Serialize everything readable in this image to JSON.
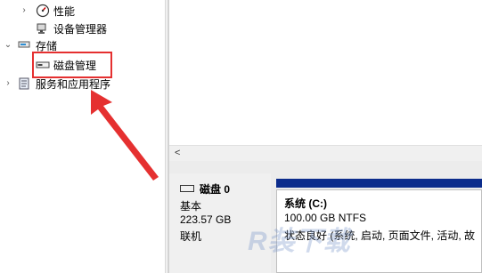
{
  "tree": {
    "items": [
      {
        "label": "性能",
        "icon": "performance-icon"
      },
      {
        "label": "设备管理器",
        "icon": "device-manager-icon"
      },
      {
        "label": "存储",
        "icon": "storage-icon"
      },
      {
        "label": "磁盘管理",
        "icon": "disk-management-icon"
      },
      {
        "label": "服务和应用程序",
        "icon": "services-apps-icon"
      }
    ]
  },
  "disk": {
    "name": "磁盘 0",
    "type": "基本",
    "size": "223.57 GB",
    "status": "联机"
  },
  "volume": {
    "title": "系统 (C:)",
    "size_fs": "100.00 GB NTFS",
    "status": "状态良好 (系统, 启动, 页面文件, 活动, 故"
  },
  "scroll": {
    "left_glyph": "<"
  },
  "watermark": "R装下载",
  "colors": {
    "highlight": "#e53030",
    "arrow": "#e53030",
    "volume_bar": "#0c2c8c"
  }
}
